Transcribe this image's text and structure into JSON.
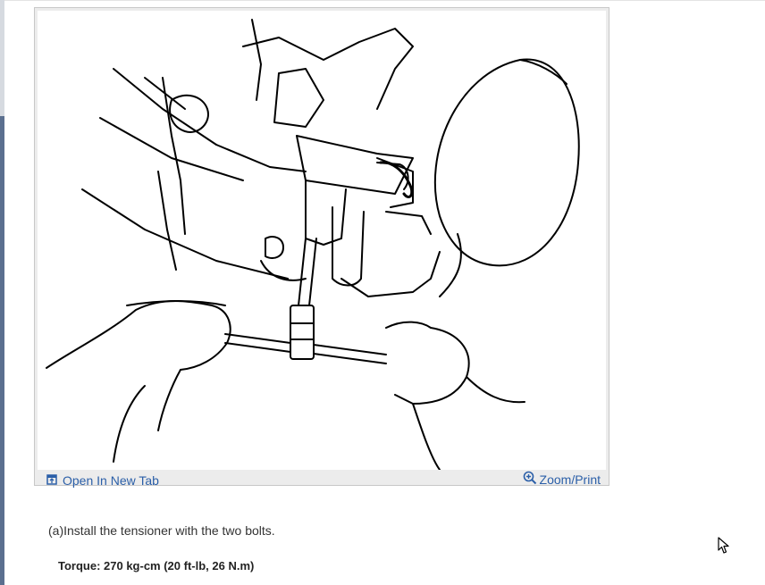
{
  "figure": {
    "open_in_new_tab_label": "Open In New Tab",
    "zoom_print_label": "Zoom/Print",
    "accent_color": "#2b5fa8",
    "icons": [
      "open-new-tab-icon",
      "magnifier-icon"
    ]
  },
  "content": {
    "step_text": "(a)Install the tensioner with the two bolts.",
    "torque_text": "Torque: 270 kg-cm (20 ft-lb, 26 N.m)"
  }
}
